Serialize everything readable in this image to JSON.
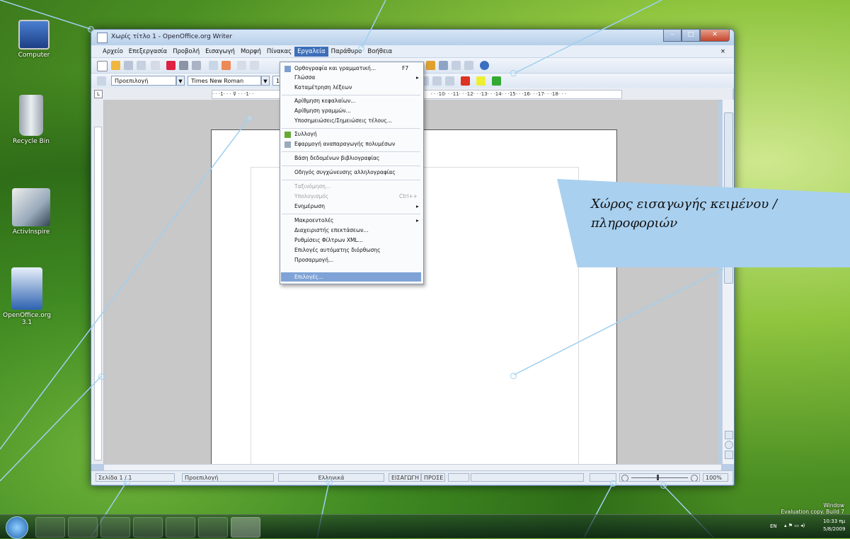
{
  "desktop": {
    "icons": [
      {
        "label": "Computer",
        "icon": "computer-icon"
      },
      {
        "label": "Recycle Bin",
        "icon": "recycle-bin-icon"
      },
      {
        "label": "ActivInspire",
        "icon": "activinspire-icon"
      },
      {
        "label": "OpenOffice.org 3.1",
        "icon": "openoffice-icon"
      }
    ],
    "watermark_line1": "Window",
    "watermark_line2": "Evaluation copy. Build 7"
  },
  "window": {
    "title": "Χωρίς τίτλο 1 - OpenOffice.org Writer",
    "close_doc": "×"
  },
  "menubar": {
    "items": [
      "Αρχείο",
      "Επεξεργασία",
      "Προβολή",
      "Εισαγωγή",
      "Μορφή",
      "Πίνακας",
      "Εργαλεία",
      "Παράθυρο",
      "Βοήθεια"
    ],
    "active": "Εργαλεία"
  },
  "toolbar": {
    "style_value": "Προεπιλογή",
    "font_value": "Times New Roman",
    "size_value": "1"
  },
  "ruler": {
    "left": "· · ·1· · · ⊽ · · ·1· ·",
    "right": "· · ·10· · ·11· · ·12· · ·13· · ·14· · ·15· · ·16· · ·17· · ·18· · ·"
  },
  "tools_menu": {
    "items": [
      {
        "label": "Ορθογραφία και γραμματική...",
        "shortcut": "F7",
        "disabled": false
      },
      {
        "label": "Γλώσσα",
        "submenu": true,
        "disabled": false
      },
      {
        "label": "Καταμέτρηση λέξεων",
        "disabled": false
      },
      {
        "label": "Αρίθμηση κεφαλαίων...",
        "disabled": false
      },
      {
        "label": "Αρίθμηση γραμμών...",
        "disabled": false
      },
      {
        "label": "Υποσημειώσεις/Σημειώσεις τέλους...",
        "disabled": false
      },
      {
        "label": "Συλλογή",
        "disabled": false
      },
      {
        "label": "Εφαρμογή αναπαραγωγής πολυμέσων",
        "disabled": false
      },
      {
        "label": "Βάση δεδομένων βιβλιογραφίας",
        "disabled": false
      },
      {
        "label": "Οδηγός συγχώνευσης αλληλογραφίας",
        "disabled": false
      },
      {
        "label": "Ταξινόμηση...",
        "disabled": true
      },
      {
        "label": "Υπολογισμός",
        "shortcut": "Ctrl++",
        "disabled": true
      },
      {
        "label": "Ενημέρωση",
        "submenu": true,
        "disabled": false
      },
      {
        "label": "Μακροεντολές",
        "submenu": true,
        "disabled": false
      },
      {
        "label": "Διαχειριστής επεκτάσεων...",
        "disabled": false
      },
      {
        "label": "Ρυθμίσεις Φίλτρων XML...",
        "disabled": false
      },
      {
        "label": "Επιλογές αυτόματης διόρθωσης",
        "disabled": false
      },
      {
        "label": "Προσαρμογή...",
        "disabled": false
      },
      {
        "label": "Επιλογές...",
        "disabled": false,
        "highlighted": true
      }
    ]
  },
  "callout": {
    "text_line1": "Χώρος εισαγωγής κειμένου /",
    "text_line2": "πληροφοριών"
  },
  "statusbar": {
    "page": "Σελίδα 1 / 1",
    "style": "Προεπιλογή",
    "language": "Ελληνικά",
    "insert_mode": "ΕΙΣΑΓΩΓΗ",
    "selection_mode": "ΠΡΟΣΕ",
    "zoom": "100%"
  },
  "tray": {
    "lang": "EN",
    "time": "10:33 πμ",
    "date": "5/8/2009"
  },
  "colors": {
    "accent": "#3d6fb8",
    "callout": "#a9d0ef",
    "pointer": "#9fd0f0"
  }
}
